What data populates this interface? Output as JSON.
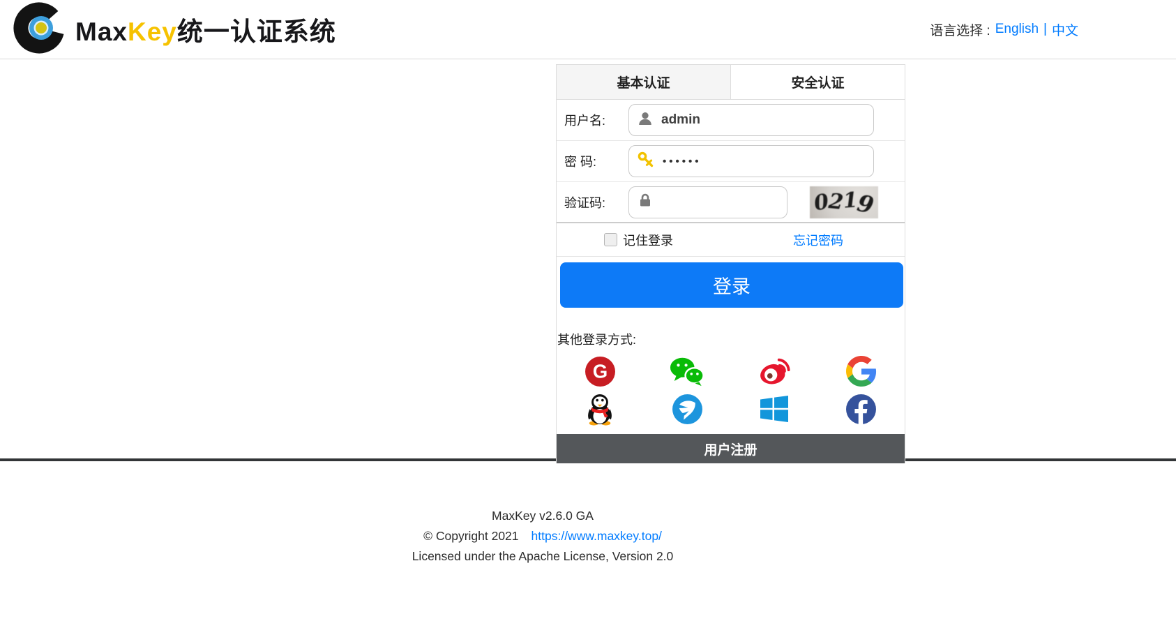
{
  "header": {
    "brand_max": "Max",
    "brand_key": "Key",
    "brand_suffix": "统一认证系统",
    "language_label": "语言选择 :",
    "language_english": "English",
    "language_separator": "|",
    "language_chinese": "中文"
  },
  "login": {
    "tabs": [
      {
        "label": "基本认证",
        "active": true
      },
      {
        "label": "安全认证",
        "active": false
      }
    ],
    "fields": {
      "username": {
        "label": "用户名:",
        "value": "admin",
        "icon": "user-icon"
      },
      "password": {
        "label": "密  码:",
        "value": "••••••",
        "icon": "key-icon"
      },
      "captcha": {
        "label": "验证码:",
        "value": "",
        "icon": "lock-icon",
        "image_text": "0219",
        "digits": [
          "0",
          "2",
          "1",
          "9"
        ]
      }
    },
    "remember_label": "记住登录",
    "forgot_link": "忘记密码",
    "submit_label": "登录",
    "other_methods_label": "其他登录方式:",
    "social": [
      {
        "name": "gitee-icon",
        "letter": "G"
      },
      {
        "name": "wechat-icon"
      },
      {
        "name": "weibo-icon"
      },
      {
        "name": "google-icon"
      },
      {
        "name": "qq-icon"
      },
      {
        "name": "dingtalk-icon"
      },
      {
        "name": "windows-icon"
      },
      {
        "name": "facebook-icon",
        "letter": "f"
      }
    ],
    "register_label": "用户注册"
  },
  "footer": {
    "version": "MaxKey  v2.6.0 GA",
    "copyright": "© Copyright 2021",
    "site_link": "https://www.maxkey.top/",
    "license": "Licensed under the Apache License, Version 2.0"
  },
  "colors": {
    "primary_blue": "#0d7af7",
    "link_blue": "#007bff",
    "brand_yellow": "#f6c200",
    "register_bar": "#54575a",
    "gitee_red": "#c71d23",
    "wechat_green": "#09bb07",
    "weibo_red": "#e6162d",
    "windows_blue": "#1296db",
    "facebook_blue": "#35529c",
    "dingtalk_blue": "#1d95dd"
  }
}
